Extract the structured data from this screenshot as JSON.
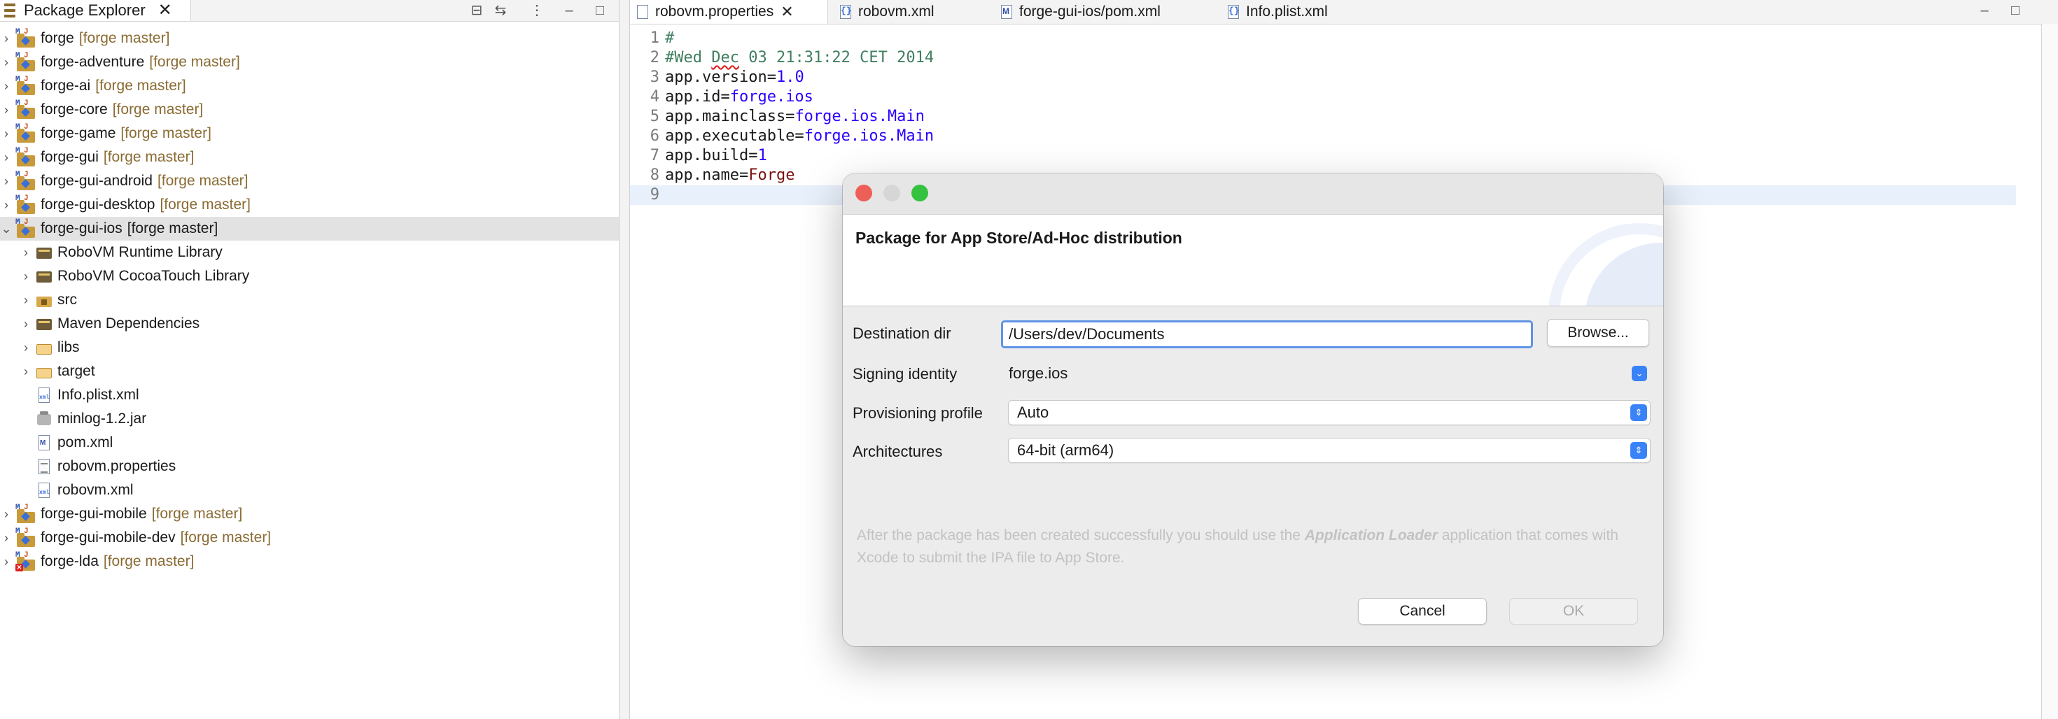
{
  "package_explorer": {
    "tab_label": "Package Explorer",
    "projects_top": [
      {
        "name": "forge",
        "branch": "[forge master]"
      },
      {
        "name": "forge-adventure",
        "branch": "[forge master]"
      },
      {
        "name": "forge-ai",
        "branch": "[forge master]"
      },
      {
        "name": "forge-core",
        "branch": "[forge master]"
      },
      {
        "name": "forge-game",
        "branch": "[forge master]"
      },
      {
        "name": "forge-gui",
        "branch": "[forge master]"
      },
      {
        "name": "forge-gui-android",
        "branch": "[forge master]"
      },
      {
        "name": "forge-gui-desktop",
        "branch": "[forge master]"
      }
    ],
    "selected_project": {
      "name": "forge-gui-ios",
      "branch": "[forge master]"
    },
    "children": [
      "RoboVM Runtime Library",
      "RoboVM CocoaTouch Library",
      "src",
      "Maven Dependencies",
      "libs",
      "target",
      "Info.plist.xml",
      "minlog-1.2.jar",
      "pom.xml",
      "robovm.properties",
      "robovm.xml"
    ],
    "projects_bottom": [
      {
        "name": "forge-gui-mobile",
        "branch": "[forge master]"
      },
      {
        "name": "forge-gui-mobile-dev",
        "branch": "[forge master]"
      },
      {
        "name": "forge-lda",
        "branch": "[forge master]"
      }
    ]
  },
  "editor": {
    "tabs": [
      "robovm.properties",
      "robovm.xml",
      "forge-gui-ios/pom.xml",
      "Info.plist.xml"
    ],
    "lines": [
      {
        "n": "1",
        "text": "#"
      },
      {
        "n": "2",
        "pre": "#Wed ",
        "sq": "Dec",
        "post": " 03 21:31:22 CET 2014"
      },
      {
        "n": "3",
        "key": "app.version=",
        "val": "1.0"
      },
      {
        "n": "4",
        "key": "app.id=",
        "val": "forge.ios"
      },
      {
        "n": "5",
        "key": "app.mainclass=",
        "val": "forge.ios.Main"
      },
      {
        "n": "6",
        "key": "app.executable=",
        "val": "forge.ios.Main"
      },
      {
        "n": "7",
        "key": "app.build=",
        "val": "1"
      },
      {
        "n": "8",
        "key": "app.name=",
        "val": "Forge"
      },
      {
        "n": "9",
        "text": ""
      }
    ]
  },
  "dialog": {
    "title": "Package for App Store/Ad-Hoc distribution",
    "labels": {
      "destination": "Destination dir",
      "signing": "Signing identity",
      "provisioning": "Provisioning profile",
      "architectures": "Architectures"
    },
    "destination_value": "/Users/dev/Documents",
    "browse_label": "Browse...",
    "signing_value": "forge.ios",
    "provisioning_value": "Auto",
    "architectures_value": "64-bit (arm64)",
    "info_pre": "After the package has been created successfully you should use the ",
    "info_em": "Application Loader",
    "info_post": " application that comes with Xcode to submit the IPA file to App Store.",
    "cancel_label": "Cancel",
    "ok_label": "OK"
  },
  "colors": {
    "branch": "#8a6b33",
    "accent": "#3a82f7",
    "close_red": "#ee5f57",
    "minimize_gray": "#d6d6d6",
    "zoom_green": "#35c23f"
  }
}
